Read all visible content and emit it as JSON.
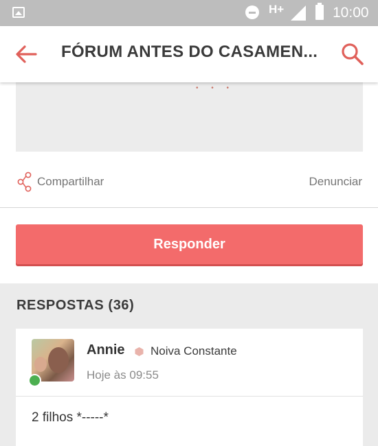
{
  "status_bar": {
    "network": "H+",
    "time": "10:00"
  },
  "app_bar": {
    "title": "FÓRUM ANTES DO CASAMEN..."
  },
  "post_actions": {
    "share_label": "Compartilhar",
    "report_label": "Denunciar"
  },
  "reply_button": {
    "label": "Responder"
  },
  "replies": {
    "header": "RESPOSTAS (36)",
    "items": [
      {
        "author": "Annie",
        "rank": "Noiva Constante",
        "time": "Hoje às 09:55",
        "body": "2 filhos *-----*",
        "online": true
      }
    ]
  },
  "colors": {
    "accent": "#f36b6b",
    "icon_accent": "#e0605a",
    "online": "#4caf50",
    "rank_badge": "#e9b3ab"
  },
  "icons": {
    "back": "arrow-left-icon",
    "search": "search-icon",
    "share": "share-icon",
    "rank": "hexagon-badge-icon"
  }
}
